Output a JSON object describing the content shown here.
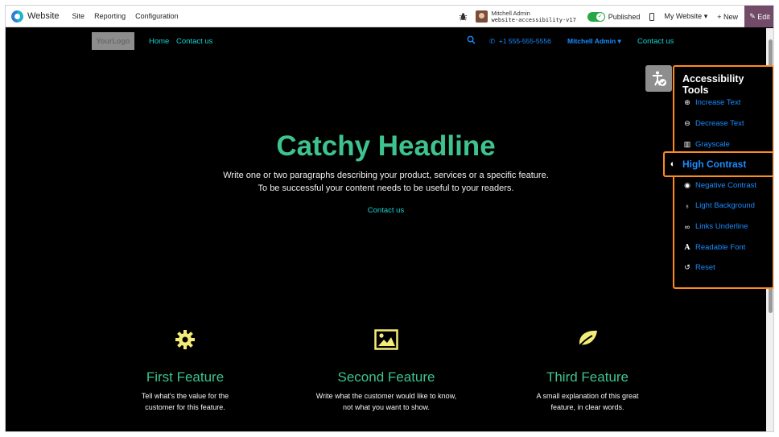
{
  "adminbar": {
    "app_title": "Website",
    "menu": [
      "Site",
      "Reporting",
      "Configuration"
    ],
    "user_name": "Mitchell Admin",
    "database": "website-accessibility-v17",
    "published_label": "Published",
    "my_website_label": "My Website",
    "new_label": "New",
    "edit_label": "Edit"
  },
  "site_header": {
    "logo_text": "YourLogo",
    "nav": [
      "Home",
      "Contact us"
    ],
    "phone": "+1 555-555-5556",
    "user_menu": "Mitchell Admin",
    "cta": "Contact us"
  },
  "hero": {
    "title": "Catchy Headline",
    "line1": "Write one or two paragraphs describing your product, services or a specific feature.",
    "line2": "To be successful your content needs to be useful to your readers.",
    "link": "Contact us"
  },
  "features": [
    {
      "icon": "gear-icon",
      "title": "First Feature",
      "line1": "Tell what's the value for the",
      "line2": "customer for this feature."
    },
    {
      "icon": "image-icon",
      "title": "Second Feature",
      "line1": "Write what the customer would like to know,",
      "line2": "not what you want to show."
    },
    {
      "icon": "leaf-icon",
      "title": "Third Feature",
      "line1": "A small explanation of this great",
      "line2": "feature, in clear words."
    }
  ],
  "accessibility": {
    "title": "Accessibility Tools",
    "items": [
      {
        "label": "Increase Text",
        "icon": "zoom-in-icon"
      },
      {
        "label": "Decrease Text",
        "icon": "zoom-out-icon"
      },
      {
        "label": "Grayscale",
        "icon": "barcode-icon"
      },
      {
        "label": "High Contrast",
        "icon": "contrast-icon"
      },
      {
        "label": "Negative Contrast",
        "icon": "eye-icon"
      },
      {
        "label": "Light Background",
        "icon": "bulb-icon"
      },
      {
        "label": "Links Underline",
        "icon": "link-icon"
      },
      {
        "label": "Readable Font",
        "icon": "font-icon"
      },
      {
        "label": "Reset",
        "icon": "reset-icon"
      }
    ],
    "active_item": "High Contrast"
  },
  "colors": {
    "accent_green": "#3ec38f",
    "link_cyan": "#16d3d3",
    "link_blue": "#1a8cff",
    "highlight_border": "#ff8a1f",
    "icon_yellow": "#f3ec78",
    "edit_button": "#714b67"
  }
}
